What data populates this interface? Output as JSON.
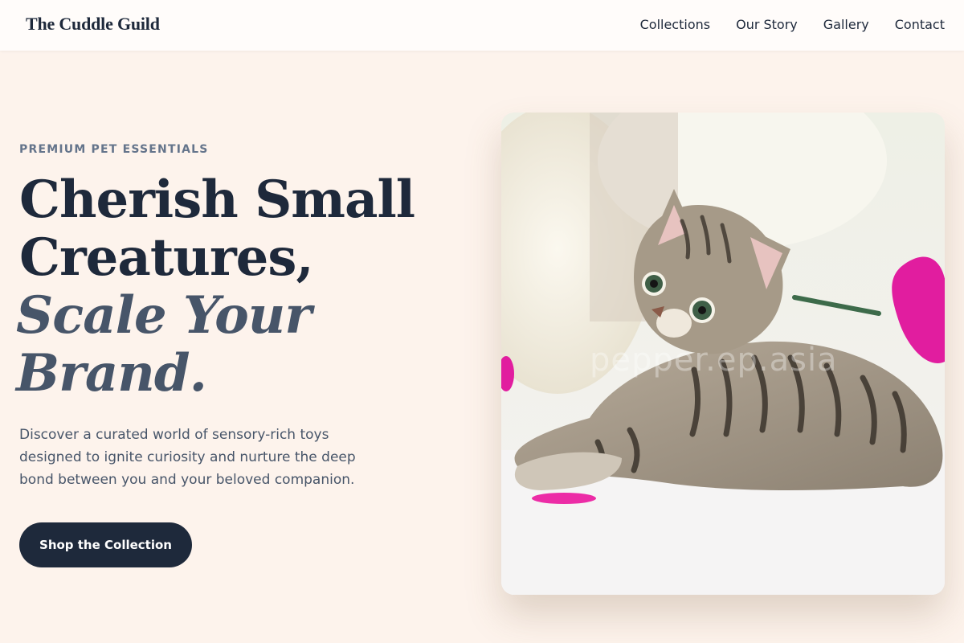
{
  "header": {
    "brand": "The Cuddle Guild",
    "nav": [
      "Collections",
      "Our Story",
      "Gallery",
      "Contact"
    ]
  },
  "hero": {
    "eyebrow": "PREMIUM PET ESSENTIALS",
    "headline_line1": "Cherish Small",
    "headline_line2": "Creatures,",
    "headline_accent1": "Scale Your",
    "headline_accent2": "Brand.",
    "description": "Discover a curated world of sensory-rich toys designed to ignite curiosity and nurture the deep bond between you and your beloved companion.",
    "cta_label": "Shop the Collection",
    "image_watermark": "pepper.ep.asia"
  },
  "colors": {
    "background": "#fdf3ec",
    "text_dark": "#1e293b",
    "accent_slate": "#475569",
    "muted": "#64748b"
  }
}
